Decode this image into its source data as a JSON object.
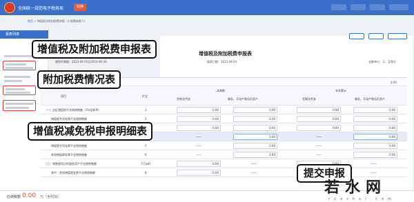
{
  "header": {
    "site_title": "全国统一规范电子税务局",
    "switch_label": "切换",
    "breadcrumb_home": "首页",
    "breadcrumb_path": "增值税及附加税费申报（小规模纳税人）"
  },
  "sidebar": {
    "title": "报表列表",
    "items": [
      "增值税及附加税费申报表",
      "附加税费情况表",
      "增值税减免税申报明细表"
    ]
  },
  "form": {
    "title": "增值税及附加税费申报表",
    "period_label": "税款所属期：2023-04-01至2023-06-30",
    "fill_date": "填表日期：2023-08-04",
    "unit_label": "金额单位：元，至角分",
    "col_item": "项目",
    "col_line": "栏次",
    "col_current": "本期数",
    "col_cumulative": "本年累计",
    "sub_goods": "货物及劳务",
    "sub_services": "服务、不动产和无形资产",
    "top_value": "0.00",
    "rows": [
      {
        "item": "（一）应征增值税不含税销售额（3%征收率）",
        "line": "1",
        "v1": "0.00",
        "v2": "0.00",
        "v3": "0.00",
        "v4": "0.00"
      },
      {
        "item": "增值税专用发票不含税销售额",
        "line": "2",
        "v1": "0.00",
        "v2": "0.00",
        "v3": "0.00",
        "v4": "0.00"
      },
      {
        "item": "其他增值税发票不含税销售额",
        "line": "3",
        "v1": "0.00",
        "v2": "0.00",
        "v3": "0.00",
        "v4": "0.00"
      },
      {
        "item": "（二）应征增值税不含税销售额（5%征收率）",
        "line": "4",
        "v1": "——",
        "v2": "0.00",
        "v3": "——",
        "v4": "0.00"
      },
      {
        "item": "增值税专用发票不含税销售额",
        "line": "5",
        "v1": "——",
        "v2": "0.00",
        "v3": "——",
        "v4": "0.00"
      },
      {
        "item": "其他增值税发票不含税销售额",
        "line": "6",
        "v1": "——",
        "v2": "0.00",
        "v3": "——",
        "v4": "0.00"
      },
      {
        "item": "（三）销售使用过的固定资产不含税销售额",
        "line": "7(7≥8)",
        "v1": "0.00",
        "v2": "——",
        "v3": "0.00",
        "v4": "——"
      },
      {
        "item": "其中：其他增值税发票不含税销售额",
        "line": "8",
        "v1": "0.00",
        "v2": "——",
        "v3": "0.00",
        "v4": "——"
      }
    ]
  },
  "callouts": {
    "main_form": "增值税及附加税费申报表",
    "surcharge": "附加税费情况表",
    "reduction": "增值税减免税申报明细表",
    "submit": "提交申报"
  },
  "bottom": {
    "tax_label": "应纳税额",
    "amount": "0.00",
    "unit": "元（含附加）"
  },
  "watermark": {
    "main": "若水网",
    "sub": "ruoshui.com"
  },
  "colors": {
    "brand_blue": "#3a6fc9",
    "alert_red": "#e23b34",
    "amount_red": "#e2462f"
  }
}
